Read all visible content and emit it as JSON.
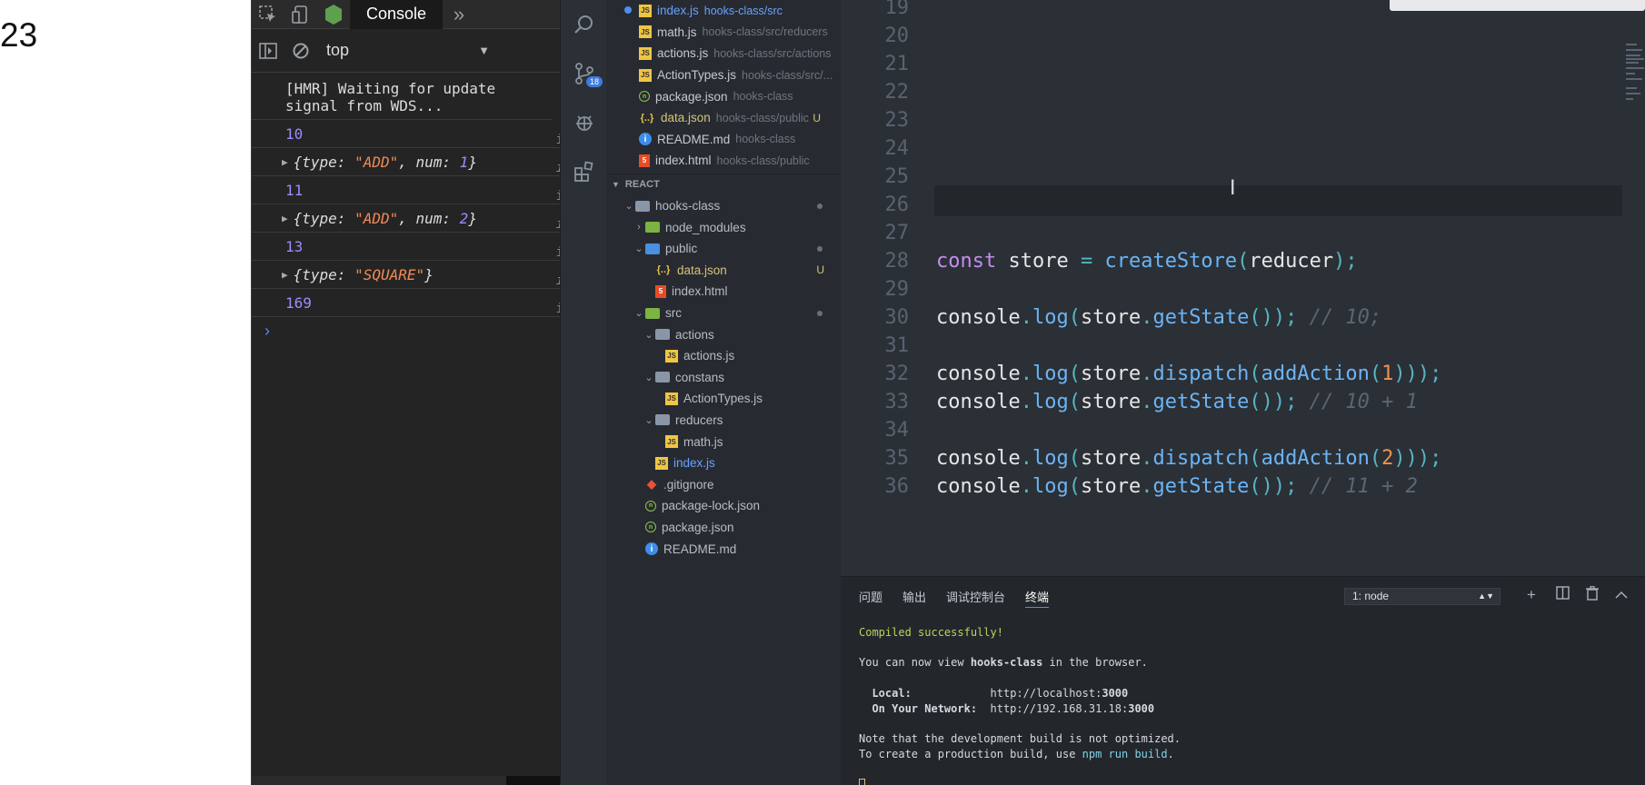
{
  "page": {
    "number": "23"
  },
  "devtools": {
    "tab_label": "Console",
    "context_select": "top",
    "console": {
      "hmr_message": "[HMR] Waiting for update signal from WDS...",
      "logs": [
        {
          "kind": "number",
          "value": "10"
        },
        {
          "kind": "object",
          "type": "\"ADD\"",
          "num": "1"
        },
        {
          "kind": "number",
          "value": "11"
        },
        {
          "kind": "object",
          "type": "\"ADD\"",
          "num": "2"
        },
        {
          "kind": "number",
          "value": "13"
        },
        {
          "kind": "object",
          "type": "\"SQUARE\""
        },
        {
          "kind": "number",
          "value": "169"
        }
      ],
      "source_link": "i",
      "prompt": "›"
    }
  },
  "activity_bar": {
    "scm_badge": "18"
  },
  "sidebar": {
    "open_editors": [
      {
        "name": "index.js",
        "path": "hooks-class/src",
        "icon": "js-file-icon",
        "active": true,
        "dirty": true
      },
      {
        "name": "math.js",
        "path": "hooks-class/src/reducers",
        "icon": "js-file-icon"
      },
      {
        "name": "actions.js",
        "path": "hooks-class/src/actions",
        "icon": "js-file-icon"
      },
      {
        "name": "ActionTypes.js",
        "path": "hooks-class/src/...",
        "icon": "js-file-icon"
      },
      {
        "name": "package.json",
        "path": "hooks-class",
        "icon": "package-icon"
      },
      {
        "name": "data.json",
        "path": "hooks-class/public",
        "icon": "json-file-icon",
        "untracked": true,
        "git": "U"
      },
      {
        "name": "README.md",
        "path": "hooks-class",
        "icon": "info-icon"
      },
      {
        "name": "index.html",
        "path": "hooks-class/public",
        "icon": "html-file-icon"
      }
    ],
    "section_title": "REACT",
    "tree": [
      {
        "name": "hooks-class",
        "depth": 0,
        "kind": "folder",
        "open": true,
        "mod": true
      },
      {
        "name": "node_modules",
        "depth": 1,
        "kind": "folder-green",
        "open": false
      },
      {
        "name": "public",
        "depth": 1,
        "kind": "folder-blue",
        "open": true,
        "mod": true
      },
      {
        "name": "data.json",
        "depth": 2,
        "kind": "json",
        "untracked": true,
        "git": "U"
      },
      {
        "name": "index.html",
        "depth": 2,
        "kind": "html"
      },
      {
        "name": "src",
        "depth": 1,
        "kind": "folder-green",
        "open": true,
        "mod": true
      },
      {
        "name": "actions",
        "depth": 2,
        "kind": "folder",
        "open": true
      },
      {
        "name": "actions.js",
        "depth": 3,
        "kind": "js"
      },
      {
        "name": "constans",
        "depth": 2,
        "kind": "folder",
        "open": true
      },
      {
        "name": "ActionTypes.js",
        "depth": 3,
        "kind": "js"
      },
      {
        "name": "reducers",
        "depth": 2,
        "kind": "folder",
        "open": true
      },
      {
        "name": "math.js",
        "depth": 3,
        "kind": "js"
      },
      {
        "name": "index.js",
        "depth": 2,
        "kind": "js",
        "active": true
      },
      {
        "name": ".gitignore",
        "depth": 1,
        "kind": "git"
      },
      {
        "name": "package-lock.json",
        "depth": 1,
        "kind": "pkg"
      },
      {
        "name": "package.json",
        "depth": 1,
        "kind": "pkg"
      },
      {
        "name": "README.md",
        "depth": 1,
        "kind": "info"
      }
    ]
  },
  "editor": {
    "lines": [
      {
        "n": "19",
        "tokens": []
      },
      {
        "n": "20",
        "tokens": []
      },
      {
        "n": "21",
        "tokens": []
      },
      {
        "n": "22",
        "tokens": []
      },
      {
        "n": "23",
        "tokens": []
      },
      {
        "n": "24",
        "tokens": []
      },
      {
        "n": "25",
        "tokens": []
      },
      {
        "n": "26",
        "tokens": []
      },
      {
        "n": "27",
        "tokens": []
      },
      {
        "n": "28",
        "tokens": [
          [
            "kw",
            "const"
          ],
          [
            "",
            "store "
          ],
          [
            "pn",
            "="
          ],
          [
            "",
            ""
          ],
          [
            "fn",
            " createStore"
          ],
          [
            "pn",
            "("
          ],
          [
            "",
            "reducer"
          ],
          [
            "pn",
            ");"
          ]
        ]
      },
      {
        "n": "29",
        "tokens": []
      },
      {
        "n": "30",
        "tokens": [
          [
            "",
            "console"
          ],
          [
            "pn",
            "."
          ],
          [
            "fn",
            "log"
          ],
          [
            "pn",
            "("
          ],
          [
            "",
            "store"
          ],
          [
            "pn",
            "."
          ],
          [
            "fn",
            "getState"
          ],
          [
            "pn",
            "()); "
          ],
          [
            "cm",
            "// 10;"
          ]
        ]
      },
      {
        "n": "31",
        "tokens": []
      },
      {
        "n": "32",
        "tokens": [
          [
            "",
            "console"
          ],
          [
            "pn",
            "."
          ],
          [
            "fn",
            "log"
          ],
          [
            "pn",
            "("
          ],
          [
            "",
            "store"
          ],
          [
            "pn",
            "."
          ],
          [
            "fn",
            "dispatch"
          ],
          [
            "pn",
            "("
          ],
          [
            "fn",
            "addAction"
          ],
          [
            "pn",
            "("
          ],
          [
            "nm",
            "1"
          ],
          [
            "pn",
            ")));"
          ]
        ]
      },
      {
        "n": "33",
        "tokens": [
          [
            "",
            "console"
          ],
          [
            "pn",
            "."
          ],
          [
            "fn",
            "log"
          ],
          [
            "pn",
            "("
          ],
          [
            "",
            "store"
          ],
          [
            "pn",
            "."
          ],
          [
            "fn",
            "getState"
          ],
          [
            "pn",
            "()); "
          ],
          [
            "cm",
            "// 10 + 1"
          ]
        ]
      },
      {
        "n": "34",
        "tokens": []
      },
      {
        "n": "35",
        "tokens": [
          [
            "",
            "console"
          ],
          [
            "pn",
            "."
          ],
          [
            "fn",
            "log"
          ],
          [
            "pn",
            "("
          ],
          [
            "",
            "store"
          ],
          [
            "pn",
            "."
          ],
          [
            "fn",
            "dispatch"
          ],
          [
            "pn",
            "("
          ],
          [
            "fn",
            "addAction"
          ],
          [
            "pn",
            "("
          ],
          [
            "nm",
            "2"
          ],
          [
            "pn",
            ")));"
          ]
        ]
      },
      {
        "n": "36",
        "tokens": [
          [
            "",
            "console"
          ],
          [
            "pn",
            "."
          ],
          [
            "fn",
            "log"
          ],
          [
            "pn",
            "("
          ],
          [
            "",
            "store"
          ],
          [
            "pn",
            "."
          ],
          [
            "fn",
            "getState"
          ],
          [
            "pn",
            "()); "
          ],
          [
            "cm",
            "// 11 + 2"
          ]
        ]
      }
    ]
  },
  "panel": {
    "tabs": [
      "问题",
      "输出",
      "调试控制台",
      "终端"
    ],
    "active_tab": "终端",
    "terminal_select": "1: node",
    "terminal": {
      "compiled": "Compiled successfully!",
      "view_prefix": "You can now view ",
      "app_name": "hooks-class",
      "view_suffix": " in the browser.",
      "local_label": "Local:",
      "local_url_prefix": "http://localhost:",
      "local_port": "3000",
      "network_label": "On Your Network:",
      "network_url_prefix": "http://192.168.31.18:",
      "network_port": "3000",
      "note": "Note that the development build is not optimized.",
      "build_prefix": "To create a production build, use ",
      "build_cmd": "npm run build",
      "build_suffix": "."
    }
  }
}
